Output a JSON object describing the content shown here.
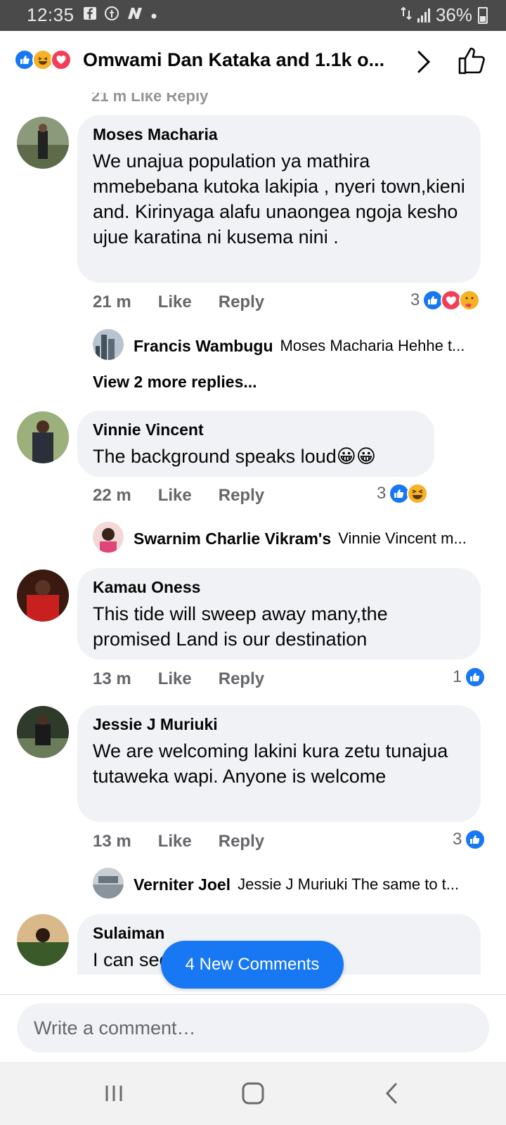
{
  "status_bar": {
    "time": "12:35",
    "battery": "36%"
  },
  "header": {
    "title": "Omwami Dan Kataka and 1.1k o...",
    "reactions": [
      "like",
      "haha",
      "love"
    ]
  },
  "partial_top_meta": "21 m   Like   Reply",
  "comments": [
    {
      "author": "Moses Macharia",
      "text": "We unajua population ya mathira mmebebana kutoka lakipia , nyeri town,kieni and. Kirinyaga alafu unaongea ngoja kesho ujue karatina ni kusema nini .",
      "time": "21 m",
      "like": "Like",
      "reply": "Reply",
      "reaction_count": "3",
      "reactions": [
        "like",
        "love",
        "care"
      ],
      "replies_preview": {
        "author": "Francis Wambugu",
        "text": "Moses Macharia Hehhe t..."
      },
      "more_replies": "View 2 more replies..."
    },
    {
      "author": "Vinnie Vincent",
      "text": "The background speaks loud😀😀",
      "time": "22 m",
      "like": "Like",
      "reply": "Reply",
      "reaction_count": "3",
      "reactions": [
        "like",
        "haha"
      ],
      "replies_preview": {
        "author": "Swarnim Charlie Vikram's",
        "text": "Vinnie Vincent m..."
      }
    },
    {
      "author": "Kamau Oness",
      "text": "This tide will sweep away many,the promised Land is our destination",
      "time": "13 m",
      "like": "Like",
      "reply": "Reply",
      "reaction_count": "1",
      "reactions": [
        "like"
      ]
    },
    {
      "author": "Jessie J Muriuki",
      "text": "We are welcoming lakini kura zetu tunajua tutaweka wapi. Anyone is welcome",
      "time": "13 m",
      "like": "Like",
      "reply": "Reply",
      "reaction_count": "3",
      "reactions": [
        "like"
      ],
      "replies_preview": {
        "author": "Verniter Joel",
        "text": "Jessie J Muriuki The same to t..."
      }
    },
    {
      "author": "Sulaiman",
      "text": "I can see ... erecting a lot"
    }
  ],
  "new_comments_pill": "4 New Comments",
  "composer": {
    "placeholder": "Write a comment…"
  },
  "colors": {
    "accent": "#1877f2",
    "bubble": "#f0f2f5",
    "meta_text": "#65676b",
    "status_bar": "#4a4a4a"
  },
  "icons": [
    "facebook-icon",
    "messenger-icon",
    "news-icon",
    "signal-icon",
    "battery-icon",
    "chevron-right-icon",
    "thumbs-up-outline-icon",
    "recents-icon",
    "home-icon",
    "back-icon"
  ]
}
